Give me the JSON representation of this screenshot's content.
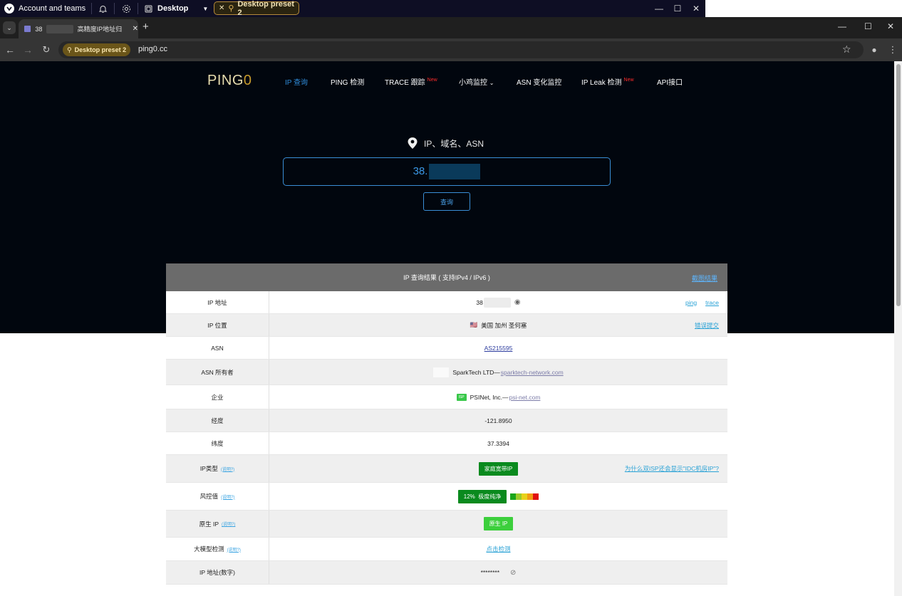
{
  "system_bar": {
    "account": "Account and teams",
    "workspace": "Desktop",
    "preset": "Desktop preset 2"
  },
  "browser": {
    "tab_title_prefix": "38",
    "tab_title": "高精度IP地址归",
    "url_chip": "Desktop preset 2",
    "url": "ping0.cc"
  },
  "site": {
    "logo_main": "PING",
    "logo_zero": "0",
    "nav": [
      {
        "label": "IP 查询",
        "active": true
      },
      {
        "label": "PING 检测"
      },
      {
        "label": "TRACE 跟踪",
        "badge": "New"
      },
      {
        "label": "小鸡监控"
      },
      {
        "label": "ASN 变化监控"
      },
      {
        "label": "IP Leak 检测",
        "badge": "New"
      },
      {
        "label": "API接口"
      }
    ],
    "search_label": "IP、域名、ASN",
    "search_value": "38.",
    "query_button": "查询"
  },
  "result": {
    "title": "IP 查询结果 ( 支持IPv4 / IPv6 )",
    "screenshot_link": "截图结果",
    "rows": {
      "ip": {
        "label": "IP 地址",
        "value": "38",
        "links": [
          "ping",
          "trace"
        ]
      },
      "location": {
        "label": "IP 位置",
        "flag": "🇺🇸",
        "value": "美国 加州 圣何塞",
        "link": "错误提交"
      },
      "asn": {
        "label": "ASN",
        "value": "AS215595"
      },
      "asn_owner": {
        "label": "ASN 所有者",
        "value": "SparkTech LTD—",
        "link": "sparktech-network.com"
      },
      "org": {
        "label": "企业",
        "tag": "ISP",
        "value": "PSINet, Inc.—",
        "link": "psi-net.com"
      },
      "longitude": {
        "label": "经度",
        "value": "-121.8950"
      },
      "latitude": {
        "label": "纬度",
        "value": "37.3394"
      },
      "ip_type": {
        "label": "IP类型",
        "help": "(说明?)",
        "value": "家庭宽带IP",
        "link": "为什么双ISP还会显示\"IDC机房IP\"?"
      },
      "risk": {
        "label": "风控值",
        "help": "(说明?)",
        "value": "12%  极度纯净"
      },
      "native_ip": {
        "label": "原生 IP",
        "help": "(说明?)",
        "value": "原生 IP"
      },
      "llm_check": {
        "label": "大模型检测",
        "help": "(说明?)",
        "value": "点击检测"
      },
      "ip_number": {
        "label": "IP 地址(数字)",
        "value": "********"
      }
    }
  },
  "colors": {
    "hero_bg": "#01060e",
    "accent_blue": "#2f8bd8",
    "badge_green": "#0a8a1e",
    "badge_light_green": "#3ccf3c",
    "risk_scale": [
      "#1aa51a",
      "#9ccc2a",
      "#e8d21a",
      "#f29a14",
      "#e01010"
    ]
  }
}
